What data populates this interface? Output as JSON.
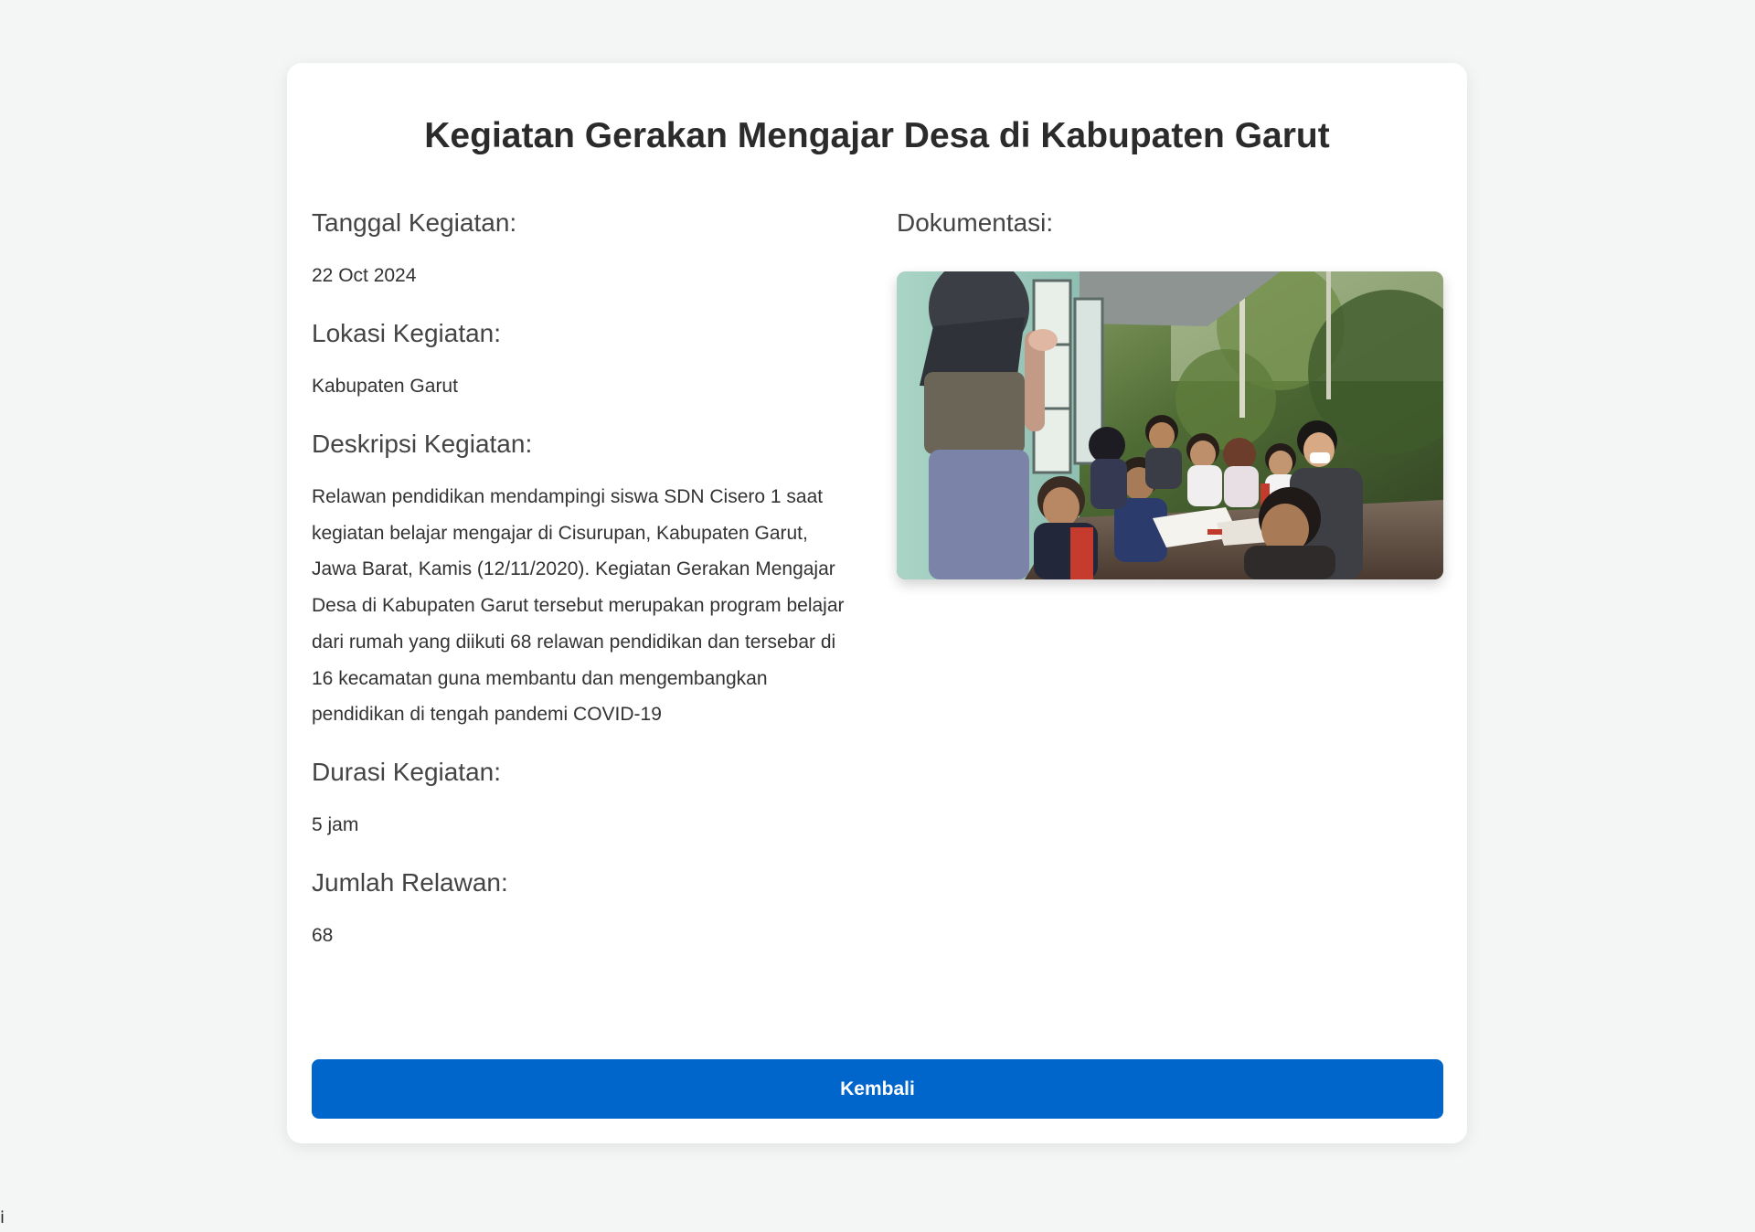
{
  "page": {
    "title": "Kegiatan Gerakan Mengajar Desa di Kabupaten Garut",
    "corner_text": "i"
  },
  "details": {
    "date_label": "Tanggal Kegiatan:",
    "date_value": "22 Oct 2024",
    "location_label": "Lokasi Kegiatan:",
    "location_value": "Kabupaten Garut",
    "description_label": "Deskripsi Kegiatan:",
    "description_value": "Relawan pendidikan mendampingi siswa SDN Cisero 1 saat kegiatan belajar mengajar di Cisurupan, Kabupaten Garut, Jawa Barat, Kamis (12/11/2020). Kegiatan Gerakan Mengajar Desa di Kabupaten Garut tersebut merupakan program belajar dari rumah yang diikuti 68 relawan pendidikan dan tersebar di 16 kecamatan guna membantu dan mengembangkan pendidikan di tengah pandemi COVID-19",
    "duration_label": "Durasi Kegiatan:",
    "duration_value": "5 jam",
    "volunteers_label": "Jumlah Relawan:",
    "volunteers_value": "68"
  },
  "documentation": {
    "label": "Dokumentasi:"
  },
  "actions": {
    "back_label": "Kembali"
  },
  "colors": {
    "background": "#f4f6f6",
    "card": "#ffffff",
    "primary_button": "#0066cc"
  }
}
